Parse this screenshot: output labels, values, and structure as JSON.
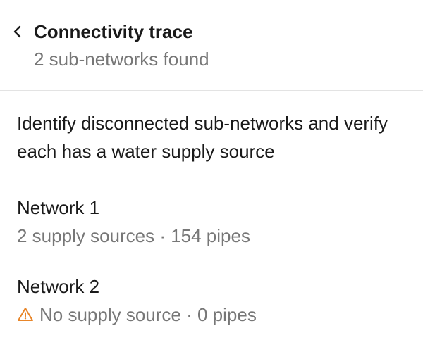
{
  "header": {
    "back_icon": "chevron-left-icon",
    "title": "Connectivity trace",
    "subtitle": "2 sub-networks found"
  },
  "description": "Identify disconnected sub-networks and verify each has a water supply source",
  "networks": [
    {
      "name": "Network 1",
      "meta": "2 supply sources · 154 pipes",
      "warning": false
    },
    {
      "name": "Network 2",
      "meta": "No supply source · 0 pipes",
      "warning": true,
      "warning_icon": "warning-triangle-icon",
      "warning_color": "#e8862a"
    }
  ],
  "colors": {
    "text_primary": "#1a1a1a",
    "text_secondary": "#777777",
    "divider": "#e3e3e3",
    "warning": "#e8862a"
  }
}
